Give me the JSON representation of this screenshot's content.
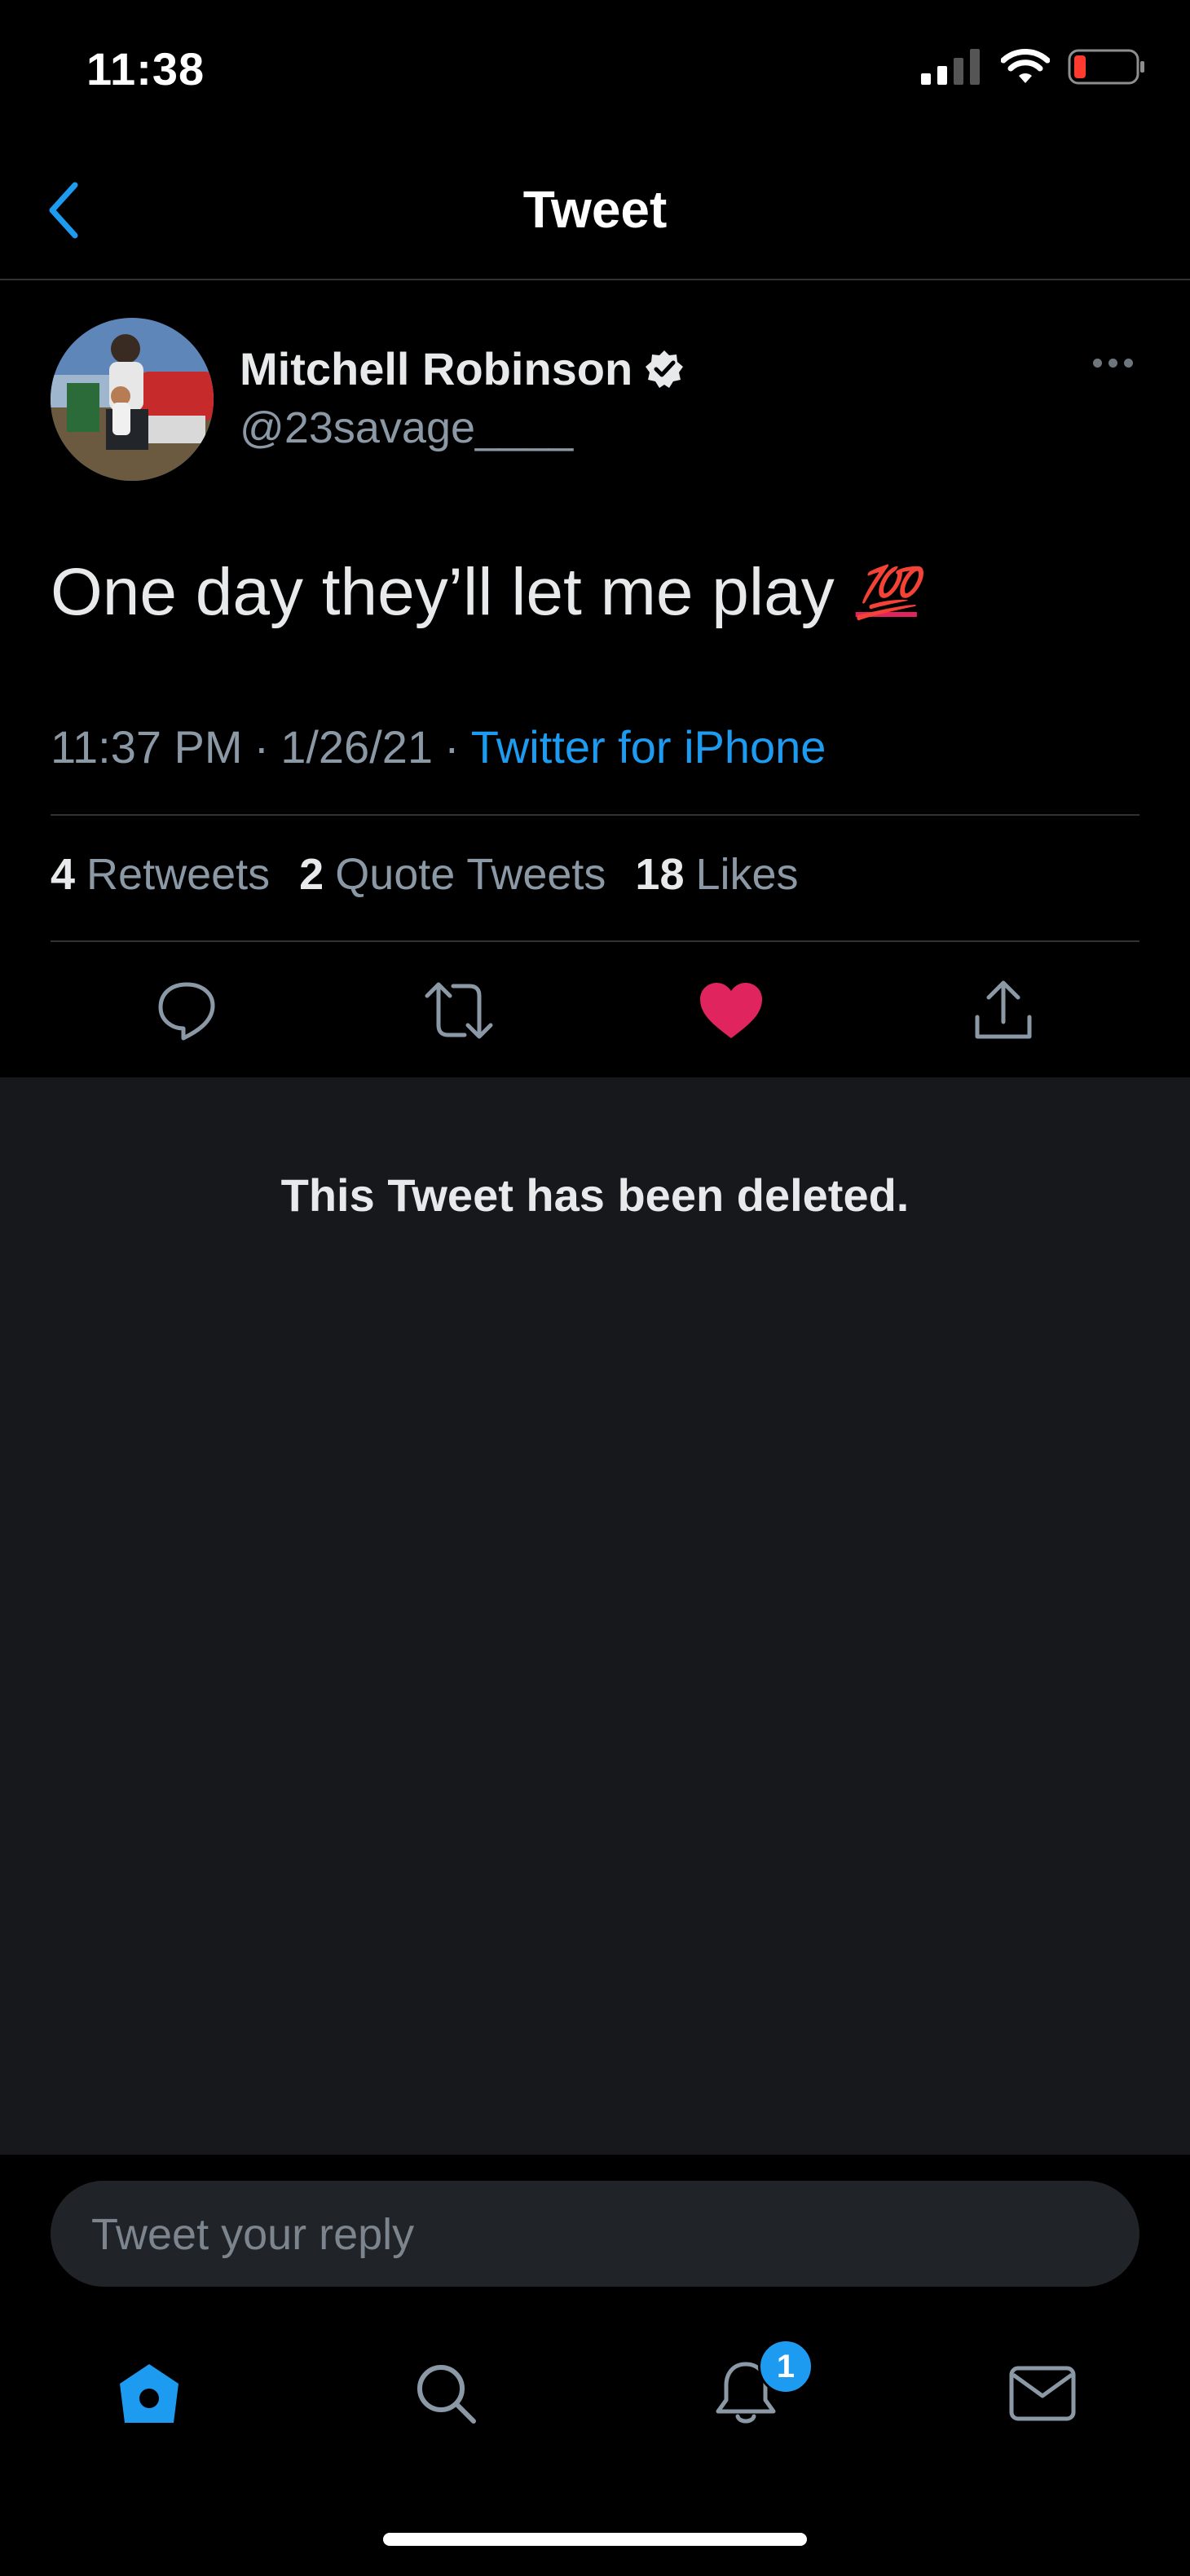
{
  "status_bar": {
    "time": "11:38",
    "icons": [
      "signal-icon",
      "wifi-icon",
      "battery-low-icon"
    ]
  },
  "nav": {
    "title": "Tweet",
    "back_icon": "chevron-left-icon"
  },
  "tweet": {
    "author_name": "Mitchell Robinson",
    "verified": true,
    "handle": "@23savage____",
    "text": "One day they’ll let me play",
    "emoji": "💯",
    "time": "11:37 PM",
    "date": "1/26/21",
    "separator": "·",
    "source": "Twitter for iPhone",
    "stats": {
      "retweets_count": "4",
      "retweets_label": "Retweets",
      "quotes_count": "2",
      "quotes_label": "Quote Tweets",
      "likes_count": "18",
      "likes_label": "Likes"
    },
    "liked": true
  },
  "deleted_notice": "This Tweet has been deleted.",
  "reply": {
    "placeholder": "Tweet your reply"
  },
  "tab_bar": {
    "items": [
      "home-icon",
      "search-icon",
      "notifications-icon",
      "messages-icon"
    ],
    "notifications_badge": "1"
  },
  "colors": {
    "accent": "#1d9bf0",
    "like": "#e0245e",
    "background": "#000000",
    "deleted_background": "#16181c"
  }
}
